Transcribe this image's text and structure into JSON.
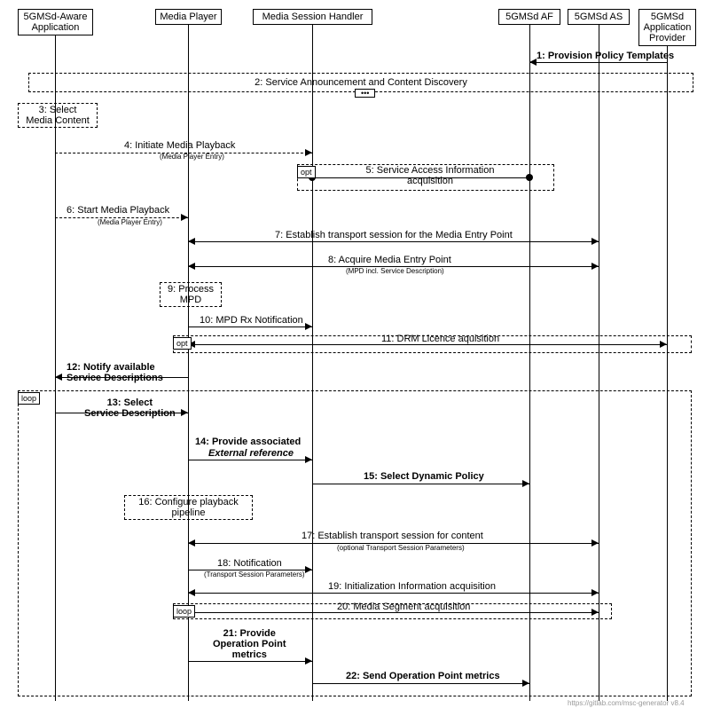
{
  "participants": {
    "p1": "5GMSd-Aware\nApplication",
    "p2": "Media Player",
    "p3": "Media Session Handler",
    "p4": "5GMSd AF",
    "p5": "5GMSd AS",
    "p6": "5GMSd\nApplication\nProvider"
  },
  "msg": {
    "m1": "1: Provision Policy Templates",
    "m2": "2: Service Announcement and Content Discovery",
    "m3": "3: Select\nMedia Content",
    "m4": "4: Initiate Media Playback",
    "m4s": "(Media Player Entry)",
    "m5": "5: Service Access Information\nacquisition",
    "m6": "6: Start Media Playback",
    "m6s": "(Media Player Entry)",
    "m7": "7: Establish transport session for the Media Entry Point",
    "m8": "8: Acquire Media Entry Point",
    "m8s": "(MPD incl. Service Description)",
    "m9": "9: Process\nMPD",
    "m10": "10: MPD Rx Notification",
    "m11": "11: DRM Licence aquisition",
    "m12": "12: Notify available\nService Descriptions",
    "m13": "13: Select\nService Description",
    "m14": "14: Provide associated",
    "m14i": "External reference",
    "m15": "15: Select Dynamic Policy",
    "m16": "16: Configure playback\npipeline",
    "m17": "17: Establish transport session for content",
    "m17s": "(optional Transport Session Parameters)",
    "m18": "18: Notification",
    "m18s": "(Transport Session Parameters)",
    "m19": "19: Initialization Information acquisition",
    "m20": "20: Media Segment acquisition",
    "m21": "21: Provide\nOperation Point\nmetrics",
    "m22": "22: Send Operation Point metrics"
  },
  "labels": {
    "opt": "opt",
    "loop": "loop"
  },
  "watermark": "https://gitlab.com/msc-generator v8.4"
}
